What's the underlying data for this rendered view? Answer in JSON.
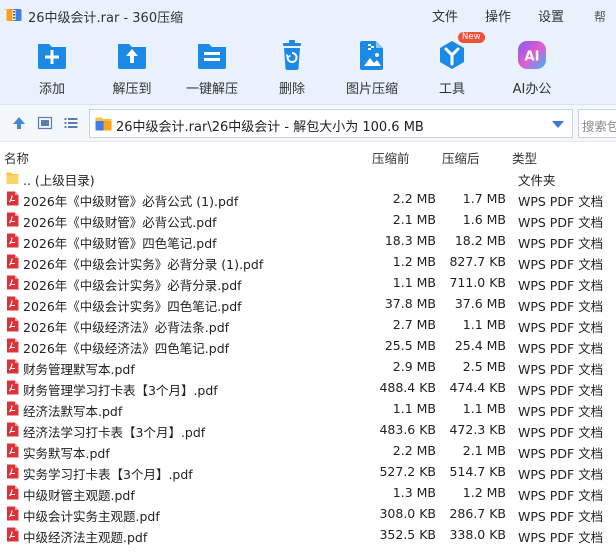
{
  "window": {
    "title": "26中级会计.rar - 360压缩",
    "menus": [
      "文件",
      "操作",
      "设置",
      "帮"
    ]
  },
  "toolbar": {
    "items": [
      {
        "label": "添加",
        "icon": "add-icon"
      },
      {
        "label": "解压到",
        "icon": "extract-to-icon"
      },
      {
        "label": "一键解压",
        "icon": "one-click-extract-icon"
      },
      {
        "label": "删除",
        "icon": "delete-icon"
      },
      {
        "label": "图片压缩",
        "icon": "image-compress-icon"
      },
      {
        "label": "工具",
        "icon": "tools-icon",
        "badge": "New"
      },
      {
        "label": "AI办公",
        "icon": "ai-office-icon",
        "icon_text": "AI"
      }
    ]
  },
  "address": {
    "path": "26中级会计.rar\\26中级会计 - 解包大小为 100.6 MB",
    "search_placeholder": "搜索包"
  },
  "columns": {
    "name": "名称",
    "compressed": "压缩前",
    "size": "压缩后",
    "type": "类型"
  },
  "files": [
    {
      "name": ".. (上级目录)",
      "before": "",
      "after": "",
      "type": "文件夹",
      "kind": "folder"
    },
    {
      "name": "2026年《中级财管》必背公式 (1).pdf",
      "before": "2.2 MB",
      "after": "1.7 MB",
      "type": "WPS PDF 文档",
      "kind": "pdf"
    },
    {
      "name": "2026年《中级财管》必背公式.pdf",
      "before": "2.1 MB",
      "after": "1.6 MB",
      "type": "WPS PDF 文档",
      "kind": "pdf"
    },
    {
      "name": "2026年《中级财管》四色笔记.pdf",
      "before": "18.3 MB",
      "after": "18.2 MB",
      "type": "WPS PDF 文档",
      "kind": "pdf"
    },
    {
      "name": "2026年《中级会计实务》必背分录 (1).pdf",
      "before": "1.2 MB",
      "after": "827.7 KB",
      "type": "WPS PDF 文档",
      "kind": "pdf"
    },
    {
      "name": "2026年《中级会计实务》必背分录.pdf",
      "before": "1.1 MB",
      "after": "711.0 KB",
      "type": "WPS PDF 文档",
      "kind": "pdf"
    },
    {
      "name": "2026年《中级会计实务》四色笔记.pdf",
      "before": "37.8 MB",
      "after": "37.6 MB",
      "type": "WPS PDF 文档",
      "kind": "pdf"
    },
    {
      "name": "2026年《中级经济法》必背法条.pdf",
      "before": "2.7 MB",
      "after": "1.1 MB",
      "type": "WPS PDF 文档",
      "kind": "pdf"
    },
    {
      "name": "2026年《中级经济法》四色笔记.pdf",
      "before": "25.5 MB",
      "after": "25.4 MB",
      "type": "WPS PDF 文档",
      "kind": "pdf"
    },
    {
      "name": "财务管理默写本.pdf",
      "before": "2.9 MB",
      "after": "2.5 MB",
      "type": "WPS PDF 文档",
      "kind": "pdf"
    },
    {
      "name": "财务管理学习打卡表【3个月】.pdf",
      "before": "488.4 KB",
      "after": "474.4 KB",
      "type": "WPS PDF 文档",
      "kind": "pdf"
    },
    {
      "name": "经济法默写本.pdf",
      "before": "1.1 MB",
      "after": "1.1 MB",
      "type": "WPS PDF 文档",
      "kind": "pdf"
    },
    {
      "name": "经济法学习打卡表【3个月】.pdf",
      "before": "483.6 KB",
      "after": "472.3 KB",
      "type": "WPS PDF 文档",
      "kind": "pdf"
    },
    {
      "name": "实务默写本.pdf",
      "before": "2.2 MB",
      "after": "2.1 MB",
      "type": "WPS PDF 文档",
      "kind": "pdf"
    },
    {
      "name": "实务学习打卡表【3个月】.pdf",
      "before": "527.2 KB",
      "after": "514.7 KB",
      "type": "WPS PDF 文档",
      "kind": "pdf"
    },
    {
      "name": "中级财管主观题.pdf",
      "before": "1.3 MB",
      "after": "1.2 MB",
      "type": "WPS PDF 文档",
      "kind": "pdf"
    },
    {
      "name": "中级会计实务主观题.pdf",
      "before": "308.0 KB",
      "after": "286.7 KB",
      "type": "WPS PDF 文档",
      "kind": "pdf"
    },
    {
      "name": "中级经济法主观题.pdf",
      "before": "352.5 KB",
      "after": "338.0 KB",
      "type": "WPS PDF 文档",
      "kind": "pdf"
    }
  ],
  "colors": {
    "accent": "#1a8ae6",
    "pdf_red": "#d9343a",
    "folder_yellow": "#f6c342",
    "badge_red": "#f0503a",
    "toolbar_bg": "#e9f1fc"
  }
}
